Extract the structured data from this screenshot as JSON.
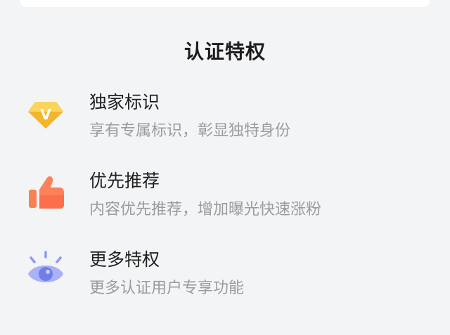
{
  "section_title": "认证特权",
  "privileges": [
    {
      "name": "独家标识",
      "desc": "享有专属标识，彰显独特身份",
      "icon": "diamond-v-icon",
      "color": "#f7c843"
    },
    {
      "name": "优先推荐",
      "desc": "内容优先推荐，增加曝光快速涨粉",
      "icon": "thumbs-up-icon",
      "color": "#fb7a52"
    },
    {
      "name": "更多特权",
      "desc": "更多认证用户专享功能",
      "icon": "eye-icon",
      "color": "#8d99f3"
    }
  ],
  "badge_letter": "V"
}
